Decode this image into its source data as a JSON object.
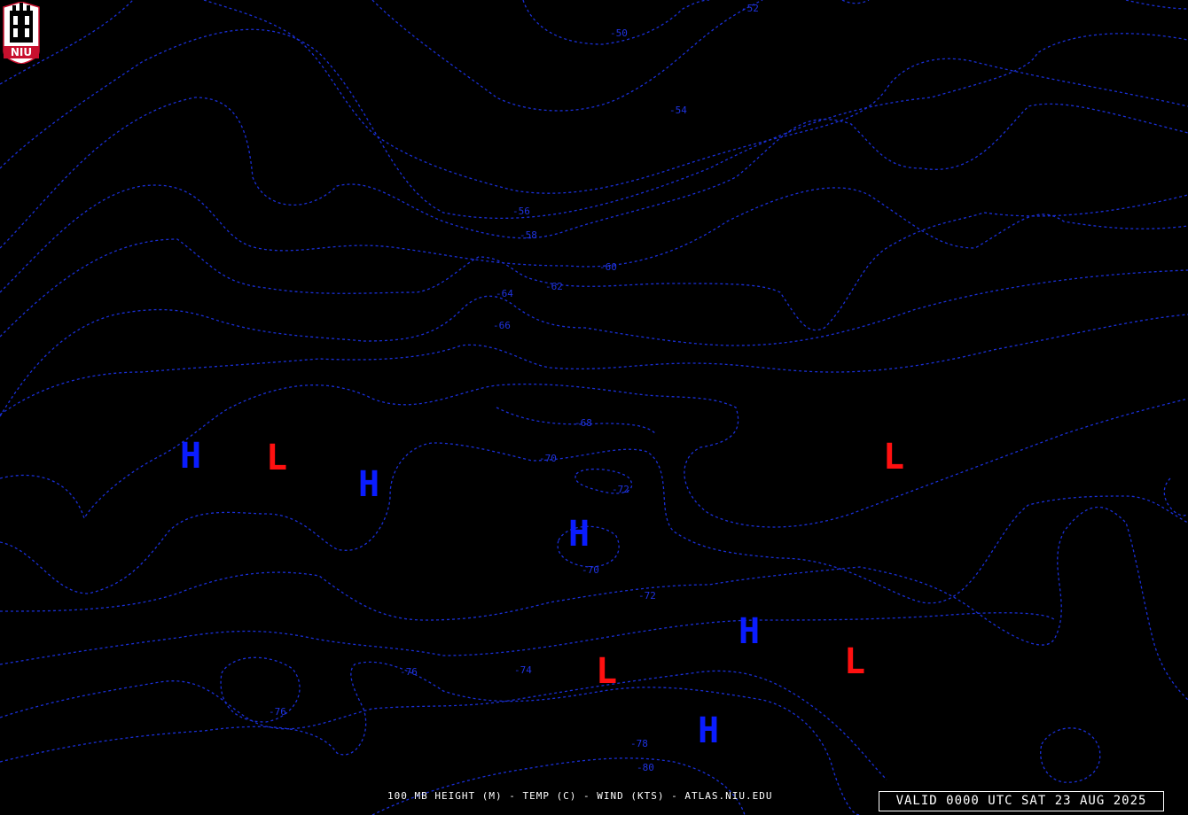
{
  "map": {
    "title": "100 MB HEIGHT (M) - TEMP (C) - WIND (KTS) - ATLAS.NIU.EDU",
    "valid_time": "VALID 0000 UTC SAT 23 AUG 2025",
    "logo": {
      "text": "NIU",
      "colors": {
        "shield": "#ffffff",
        "banner": "#c8102e",
        "tower": "#000000"
      }
    },
    "colors": {
      "background": "#000000",
      "contour": "#1a2fd6",
      "high": "#0a1cff",
      "low": "#ff1010",
      "text": "#ffffff"
    },
    "pressure_centers": [
      {
        "id": "h1",
        "type": "high",
        "label": "H"
      },
      {
        "id": "l1",
        "type": "low",
        "label": "L"
      },
      {
        "id": "h2",
        "type": "high",
        "label": "H"
      },
      {
        "id": "h3",
        "type": "high",
        "label": "H"
      },
      {
        "id": "l2",
        "type": "low",
        "label": "L"
      },
      {
        "id": "h4",
        "type": "high",
        "label": "H"
      },
      {
        "id": "l3",
        "type": "low",
        "label": "L"
      },
      {
        "id": "l4",
        "type": "low",
        "label": "L"
      },
      {
        "id": "h5",
        "type": "high",
        "label": "H"
      }
    ],
    "isotherm_labels": [
      "-52",
      "-50",
      "-54",
      "-56",
      "-58",
      "-60",
      "-62",
      "-64",
      "-66",
      "-68",
      "-70",
      "-72",
      "-70",
      "-72",
      "-74",
      "-76",
      "-76",
      "-78",
      "-80"
    ]
  }
}
